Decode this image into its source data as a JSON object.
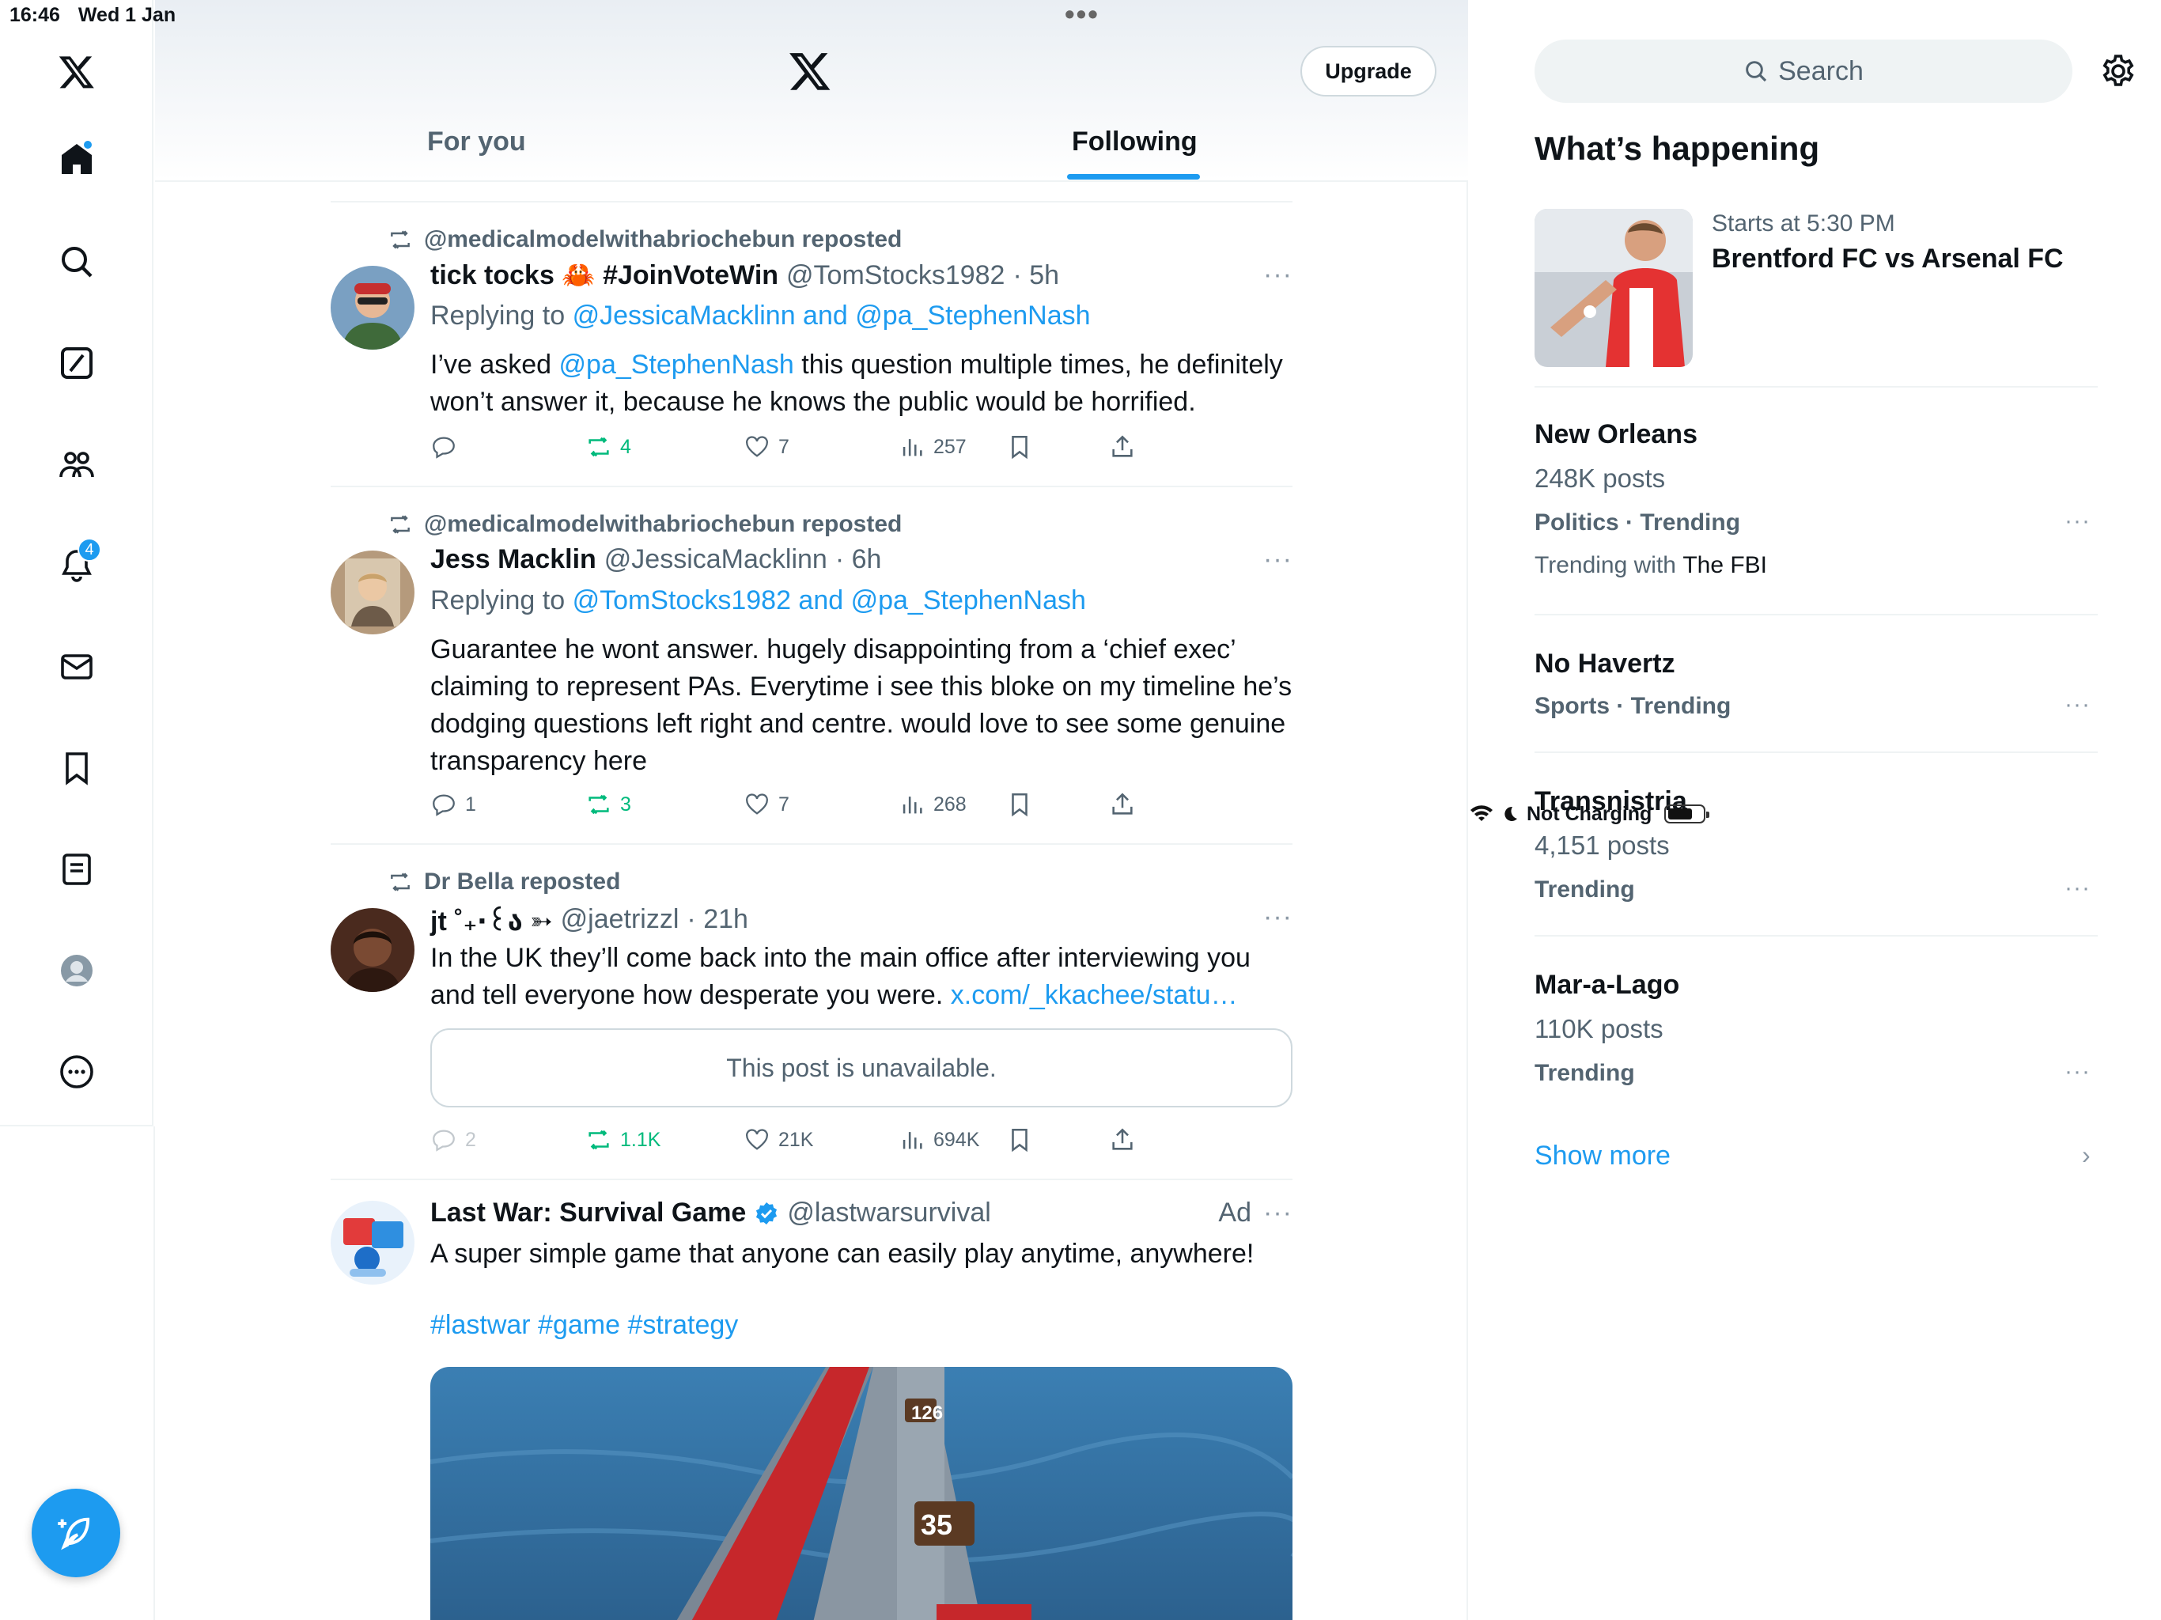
{
  "status": {
    "time": "16:46",
    "date": "Wed 1 Jan",
    "charging": "Not Charging"
  },
  "nav": {
    "notifications_badge": "4"
  },
  "header": {
    "upgrade_label": "Upgrade",
    "tabs": [
      "For you",
      "Following"
    ]
  },
  "posts": [
    {
      "repost_by": "@medicalmodelwithabriochebun reposted",
      "name": "tick tocks 🦀 #JoinVoteWin",
      "handle": "@TomStocks1982",
      "time": "· 5h",
      "replying_prefix": "Replying to",
      "replying_to": "@JessicaMacklinn and @pa_StephenNash",
      "text_before": "I’ve asked ",
      "text_mention": "@pa_StephenNash",
      "text_after": " this question multiple times, he definitely won’t answer it, because he knows the public would be horrified.",
      "replies": "",
      "reposts": "4",
      "likes": "7",
      "views": "257"
    },
    {
      "repost_by": "@medicalmodelwithabriochebun reposted",
      "name": "Jess Macklin",
      "handle": "@JessicaMacklinn",
      "time": "· 6h",
      "replying_prefix": "Replying to",
      "replying_to": "@TomStocks1982 and @pa_StephenNash",
      "text": "Guarantee he wont answer. hugely disappointing from a ‘chief exec’ claiming to represent PAs. Everytime i see this bloke on my timeline he’s dodging questions left right and centre. would love to see some genuine transparency here",
      "replies": "1",
      "reposts": "3",
      "likes": "7",
      "views": "268"
    },
    {
      "repost_by": "Dr Bella reposted",
      "name": "jt ˚₊‧꒰ა ➳",
      "handle": "@jaetrizzl",
      "time": "· 21h",
      "text": "In the UK they’ll come back into the main office after interviewing you and tell everyone how desperate you were. ",
      "link": "x.com/_kkachee/statu…",
      "unavailable": "This post is unavailable.",
      "replies": "2",
      "reposts": "1.1K",
      "likes": "21K",
      "views": "694K"
    },
    {
      "name": "Last War: Survival Game",
      "handle": "@lastwarsurvival",
      "ad": "Ad",
      "text": "A super simple game that anyone can easily play anytime, anywhere!",
      "hashtags": "#lastwar #game #strategy",
      "media_numbers": [
        "126",
        "35"
      ]
    }
  ],
  "sidebar": {
    "search_placeholder": "Search",
    "title": "What’s happening",
    "event": {
      "starts": "Starts at 5:30 PM",
      "title": "Brentford FC vs Arsenal FC"
    },
    "trends": [
      {
        "title": "New Orleans",
        "count": "248K posts",
        "category": "Politics · Trending",
        "with_prefix": "Trending with ",
        "with": "The FBI"
      },
      {
        "title": "No Havertz",
        "category": "Sports · Trending"
      },
      {
        "title": "Transnistria",
        "count": "4,151 posts",
        "category": "Trending"
      },
      {
        "title": "Mar-a-Lago",
        "count": "110K posts",
        "category": "Trending"
      }
    ],
    "show_more": "Show more"
  },
  "colors": {
    "accent": "#1d9bf0",
    "repost_green": "#00ba7c",
    "secondary_text": "#536471",
    "border": "#eff3f4"
  }
}
